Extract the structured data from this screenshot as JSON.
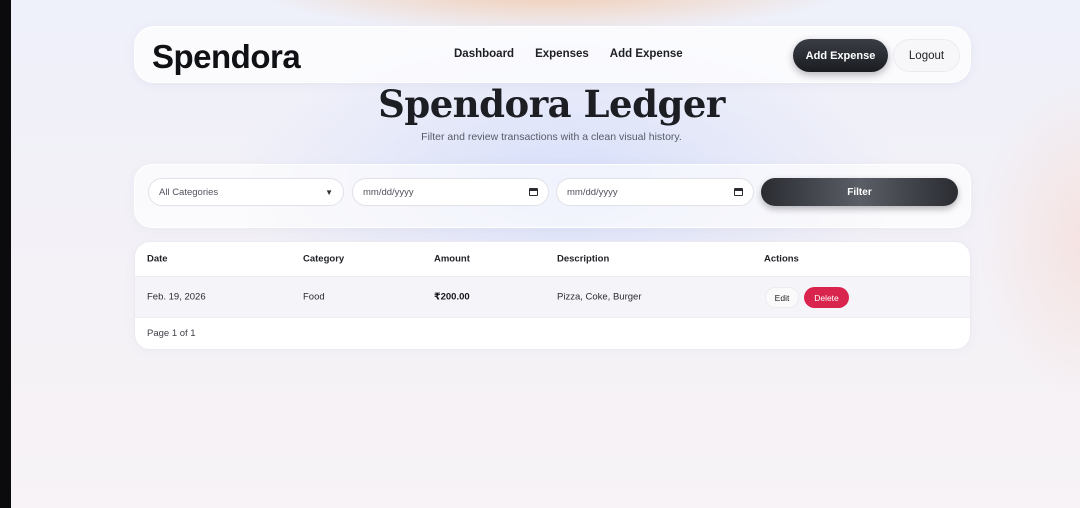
{
  "brand": "Spendora",
  "nav": {
    "links": [
      "Dashboard",
      "Expenses",
      "Add Expense"
    ],
    "add_expense_button": "Add Expense",
    "logout_button": "Logout"
  },
  "hero": {
    "title": "Spendora Ledger",
    "subtitle": "Filter and review transactions with a clean visual history."
  },
  "filters": {
    "category_selected": "All Categories",
    "start_date_placeholder": "mm/dd/yyyy",
    "end_date_placeholder": "mm/dd/yyyy",
    "filter_button": "Filter"
  },
  "table": {
    "headers": [
      "Date",
      "Category",
      "Amount",
      "Description",
      "Actions"
    ],
    "rows": [
      {
        "date": "Feb. 19, 2026",
        "category": "Food",
        "amount": "₹200.00",
        "description": "Pizza, Coke, Burger",
        "edit_label": "Edit",
        "delete_label": "Delete"
      }
    ],
    "pagination": "Page 1 of 1"
  },
  "colors": {
    "accent_dark": "#1a1c21",
    "delete_red": "#d9244e"
  }
}
